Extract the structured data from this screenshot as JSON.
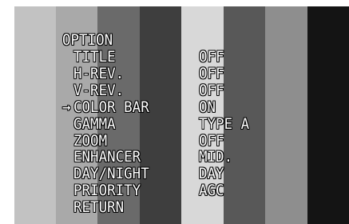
{
  "background": {
    "bar_colors": [
      "#c2c2c2",
      "#a9a9a9",
      "#6a6a6a",
      "#3e3e3e",
      "#d8d8d8",
      "#585858",
      "#8e8e8e",
      "#141414"
    ]
  },
  "menu": {
    "title": "OPTION",
    "cursor": "→",
    "selected_index": 3,
    "items": [
      {
        "label": "TITLE",
        "value": "OFF"
      },
      {
        "label": "H-REV.",
        "value": "OFF"
      },
      {
        "label": "V-REV.",
        "value": "OFF"
      },
      {
        "label": "COLOR BAR",
        "value": "ON"
      },
      {
        "label": "GAMMA",
        "value": "TYPE A"
      },
      {
        "label": "ZOOM",
        "value": "OFF"
      },
      {
        "label": "ENHANCER",
        "value": "MID."
      },
      {
        "label": "DAY/NIGHT",
        "value": "DAY"
      },
      {
        "label": "PRIORITY",
        "value": "AGC"
      },
      {
        "label": "RETURN",
        "value": ""
      }
    ]
  }
}
